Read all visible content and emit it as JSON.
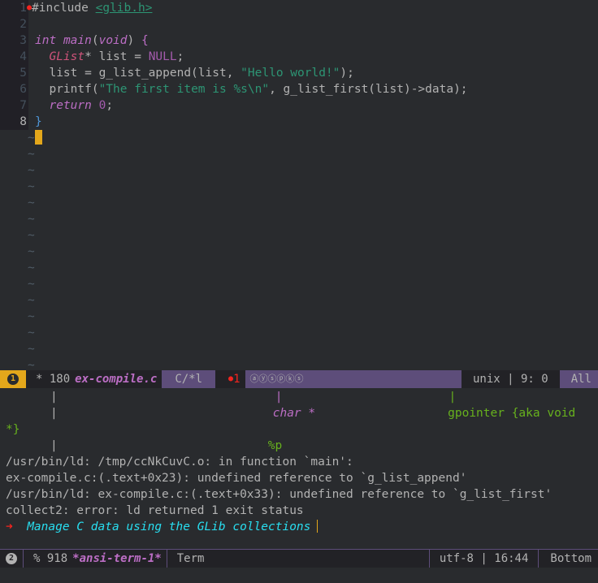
{
  "editor": {
    "lines": [
      {
        "n": "1"
      },
      {
        "n": "2"
      },
      {
        "n": "3"
      },
      {
        "n": "4"
      },
      {
        "n": "5"
      },
      {
        "n": "6"
      },
      {
        "n": "7"
      },
      {
        "n": "8"
      }
    ],
    "l1": {
      "pre": "#include ",
      "hdr": "<glib.h>"
    },
    "l3": {
      "kw1": "int",
      "fn": "main",
      "open": "(",
      "kw2": "void",
      "close": ")",
      " brace": " {"
    },
    "l4": {
      "indent": "  ",
      "ty": "GList",
      "rest": "* list = ",
      "cst": "NULL",
      ";": ";"
    },
    "l5": {
      "a": "  list = g_list_append(list, ",
      "str": "\"Hello world!\"",
      "b": ");"
    },
    "l6": {
      "a": "  printf(",
      "str": "\"The first item is %s\\n\"",
      "b": ", g_list_first(list)->data);"
    },
    "l7": {
      "indent": "  ",
      "kw": "return",
      "sp": " ",
      "num": "0",
      ";": ";"
    },
    "l8": {
      "brace": "}"
    },
    "tilde": "~"
  },
  "modeline_top": {
    "window_num": "1",
    "state": "* 180",
    "buffer": "ex-compile.c",
    "mode": "C/*l",
    "errors": "1",
    "flags": "ⓐⓨⓢⓟⓚⓢ",
    "eol": "unix | 9: 0",
    "pos": "All"
  },
  "terminal": {
    "r1": {
      "a": "|",
      "b": "|",
      "c": "|"
    },
    "r2": {
      "a": "|",
      "b": "char *",
      "c": "gpointer {aka void"
    },
    "r3": "*}",
    "r4": {
      "a": "|",
      "b": "%p"
    },
    "r5": "/usr/bin/ld: /tmp/ccNkCuvC.o: in function `main':",
    "r6": "ex-compile.c:(.text+0x23): undefined reference to `g_list_append'",
    "r7": "/usr/bin/ld: ex-compile.c:(.text+0x33): undefined reference to `g_list_first'",
    "r8": "collect2: error: ld returned 1 exit status",
    "prompt_arrow": "➜",
    "prompt": "Manage C data using the GLib collections"
  },
  "modeline_bottom": {
    "window_num": "2",
    "state": "% 918",
    "buffer": "*ansi-term-1*",
    "mode": "Term",
    "encoding": "utf-8 | 16:44",
    "pos": "Bottom"
  },
  "colors": {
    "background": "#292b2e",
    "modeline_active": "#5d4d7a",
    "cursor": "#e3a71b",
    "keyword": "#bc6ec5",
    "string": "#2d9574"
  }
}
